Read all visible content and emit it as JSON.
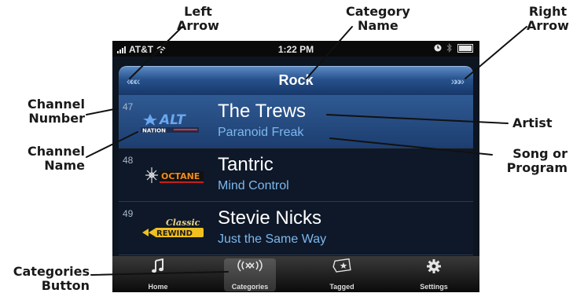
{
  "callouts": {
    "left_arrow": [
      "Left",
      "Arrow"
    ],
    "category_name": [
      "Category",
      "Name"
    ],
    "right_arrow": [
      "Right",
      "Arrow"
    ],
    "channel_number": [
      "Channel",
      "Number"
    ],
    "channel_name": [
      "Channel",
      "Name"
    ],
    "artist": [
      "Artist"
    ],
    "song_or_program": [
      "Song or",
      "Program"
    ],
    "categories_button": [
      "Categories",
      "Button"
    ]
  },
  "status_bar": {
    "carrier": "AT&T",
    "time": "1:22 PM"
  },
  "header": {
    "category": "Rock",
    "left_arrow": "«««",
    "right_arrow": "»»»"
  },
  "channels": [
    {
      "number": "47",
      "logo": "ALT NATION",
      "artist": "The Trews",
      "song": "Paranoid Freak"
    },
    {
      "number": "48",
      "logo": "OCTANE",
      "artist": "Tantric",
      "song": "Mind Control"
    },
    {
      "number": "49",
      "logo": "Classic REWIND",
      "artist": "Stevie Nicks",
      "song": "Just the Same Way"
    }
  ],
  "tabbar": [
    {
      "label": "Home",
      "icon": "music-note-icon"
    },
    {
      "label": "Categories",
      "icon": "satellite-signal-icon"
    },
    {
      "label": "Tagged",
      "icon": "tag-star-icon"
    },
    {
      "label": "Settings",
      "icon": "gear-icon"
    }
  ],
  "colors": {
    "header_blue": "#27518c",
    "song_blue": "#7cb8ee",
    "selected_row": "#2f5a93"
  }
}
